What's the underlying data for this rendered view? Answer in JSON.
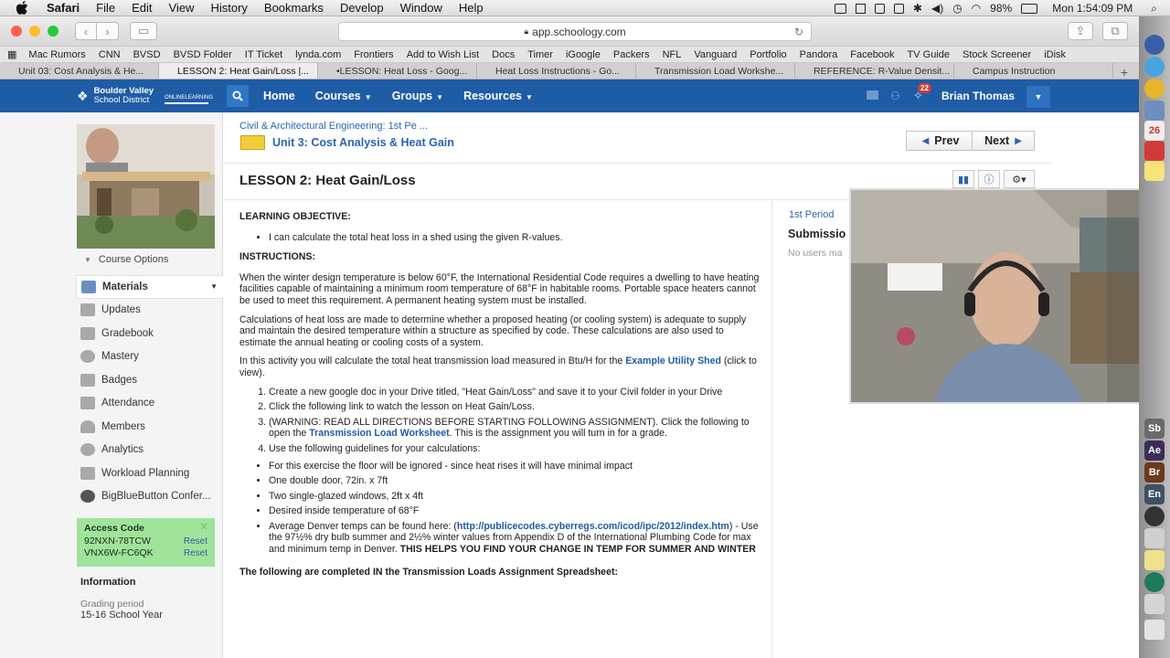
{
  "macbar": {
    "app": "Safari",
    "menus": [
      "File",
      "Edit",
      "View",
      "History",
      "Bookmarks",
      "Develop",
      "Window",
      "Help"
    ],
    "battery": "98%",
    "clock": "Mon 1:54:09 PM"
  },
  "browser": {
    "url": "app.schoology.com",
    "bookmarks": [
      "Mac Rumors",
      "CNN",
      "BVSD",
      "BVSD Folder",
      "IT Ticket",
      "lynda.com",
      "Frontiers",
      "Add to Wish List",
      "Docs",
      "Timer",
      "iGoogle",
      "Packers",
      "NFL",
      "Vanguard",
      "Portfolio",
      "Pandora",
      "Facebook",
      "TV Guide",
      "Stock Screener",
      "iDisk"
    ],
    "tabs": [
      "Unit 03: Cost Analysis & He...",
      "LESSON 2: Heat Gain/Loss |...",
      "•LESSON: Heat Loss - Goog...",
      "Heat Loss Instructions - Go...",
      "Transmission Load Workshe...",
      "REFERENCE: R-Value Densit...",
      "Campus Instruction"
    ]
  },
  "schoology": {
    "logo_line1": "Boulder Valley",
    "logo_line2": "School District",
    "logo2": "ONLINELEARNING",
    "nav": [
      "Home",
      "Courses",
      "Groups",
      "Resources"
    ],
    "notif_count": "22",
    "user": "Brian Thomas"
  },
  "sidebar": {
    "course_options": "Course Options",
    "items": [
      "Materials",
      "Updates",
      "Gradebook",
      "Mastery",
      "Badges",
      "Attendance",
      "Members",
      "Analytics",
      "Workload Planning",
      "BigBlueButton Confer..."
    ],
    "access_title": "Access Code",
    "codes": [
      "92NXN-78TCW",
      "VNX6W-FC6QK"
    ],
    "reset": "Reset",
    "info_title": "Information",
    "grading_label": "Grading period",
    "grading_value": "15-16 School Year"
  },
  "main": {
    "breadcrumb": "Civil & Architectural Engineering: 1st Pe ...",
    "unit": "Unit 3: Cost Analysis & Heat Gain",
    "prev": "Prev",
    "next": "Next",
    "title": "LESSON 2: Heat Gain/Loss",
    "objective_head": "LEARNING OBJECTIVE:",
    "objective": "I can calculate the total heat loss in a shed using the given R-values.",
    "instr_head": "INSTRUCTIONS:",
    "p1": "When the winter design temperature is below 60°F, the International Residential Code requires a dwelling to have heating facilities capable of maintaining a minimum room temperature of 68°F in habitable rooms. Portable space heaters cannot be used to meet this requirement. A permanent heating system must be installed.",
    "p2": "Calculations of heat loss are made to determine whether a proposed heating (or cooling system) is adequate to supply and maintain the desired temperature within a structure as specified by code. These calculations are also used to estimate the annual heating or cooling costs of a system.",
    "p3a": "In this activity you will calculate the total heat transmission load measured in Btu/H for the ",
    "p3link": "Example Utility Shed",
    "p3b": " (click to view).",
    "step1": "Create a new google doc in your Drive titled, \"Heat Gain/Loss\" and save it to your Civil folder in your Drive",
    "step2": "Click the following link to watch the lesson on Heat Gain/Loss.",
    "step3a": "(WARNING: READ ALL DIRECTIONS BEFORE STARTING FOLLOWING ASSIGNMENT).  Click the following to open the ",
    "step3link": "Transmission Load Worksheet",
    "step3b": ".  This is the assignment you will turn in for a grade.",
    "step4": "Use the following guidelines for your calculations:",
    "g1": "For this exercise the floor will be ignored - since heat rises it will have minimal impact",
    "g2": "One double door, 72in. x 7ft",
    "g3": "Two single-glazed windows, 2ft x 4ft",
    "g4": "Desired inside temperature of 68°F",
    "g5a": "Average Denver temps can be found here:  (",
    "g5link": "http://publicecodes.cyberregs.com/icod/ipc/2012/index.htm",
    "g5b": ") - Use the 97½% dry bulb summer and 2½% winter values from Appendix D of the International Plumbing Code for max and minimum temp in Denver.  ",
    "g5bold": "THIS HELPS YOU FIND YOUR CHANGE IN TEMP FOR SUMMER AND WINTER",
    "cut": "The following are completed IN the Transmission Loads Assignment Spreadsheet:",
    "period": "1st Period",
    "submissions": "Submissio",
    "no_users": "No users ma"
  }
}
